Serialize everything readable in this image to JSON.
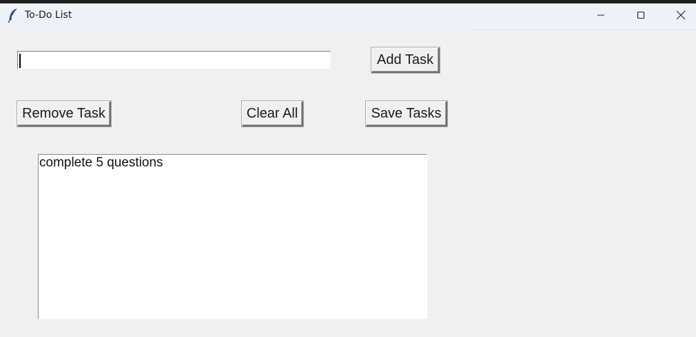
{
  "window": {
    "title": "To-Do List",
    "icons": {
      "app": "feather-icon",
      "minimize": "minimize-icon",
      "maximize": "maximize-icon",
      "close": "close-icon"
    }
  },
  "task_entry": {
    "value": "",
    "placeholder": ""
  },
  "buttons": {
    "add_task": "Add Task",
    "remove_task": "Remove Task",
    "clear_all": "Clear All",
    "save_tasks": "Save Tasks"
  },
  "task_list": {
    "items": [
      {
        "label": "complete 5 questions"
      }
    ]
  },
  "colors": {
    "background": "#f0f0f0",
    "titlebar": "#eef2f8",
    "list_background": "#ffffff"
  }
}
